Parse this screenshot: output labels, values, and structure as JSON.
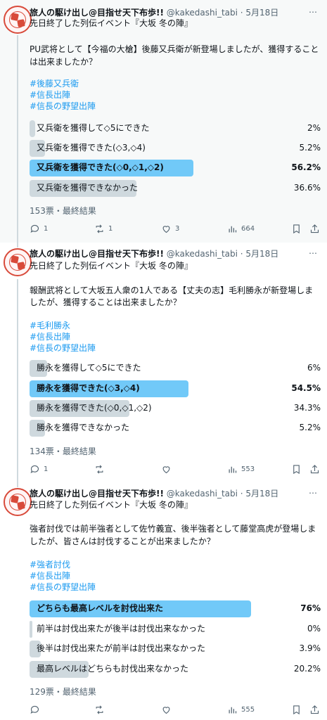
{
  "tweets": [
    {
      "author": {
        "name": "旅人の駆け出し@目指せ天下布歩!!",
        "handle": "@kakedashi_tabi",
        "date": "5月18日"
      },
      "text1": "先日終了した列伝イベント『大坂 冬の陣』",
      "text2a": "PU武将として【今福の大槍】後藤又兵衛が新登場しましたが、獲得すること",
      "text2b": "は出来ましたか？",
      "hashtags": [
        "#後藤又兵衛",
        "#信長出陣",
        "#信長の野望出陣"
      ],
      "poll": {
        "options": [
          {
            "label": "又兵衛を獲得して◇5にできた",
            "percent": "2%",
            "value": 2,
            "winner": false
          },
          {
            "label": "又兵衛を獲得できた(◇3,◇4)",
            "percent": "5.2%",
            "value": 5.2,
            "winner": false
          },
          {
            "label": "又兵衛を獲得できた(◇0,◇1,◇2)",
            "percent": "56.2%",
            "value": 56.2,
            "winner": true
          },
          {
            "label": "又兵衛を獲得できなかった",
            "percent": "36.6%",
            "value": 36.6,
            "winner": false
          }
        ],
        "footer": "153票・最終結果"
      },
      "stats": {
        "replies": "1",
        "reposts": "1",
        "likes": "3",
        "views": "664"
      }
    },
    {
      "author": {
        "name": "旅人の駆け出し@目指せ天下布歩!!",
        "handle": "@kakedashi_tabi",
        "date": "5月18日"
      },
      "text1": "先日終了した列伝イベント『大坂 冬の陣』",
      "text2a": "報酬武将として大坂五人衆の1人である【丈夫の志】毛利勝永が新登場しま",
      "text2b": "したが、獲得することは出来ましたか？",
      "hashtags": [
        "#毛利勝永",
        "#信長出陣",
        "#信長の野望出陣"
      ],
      "poll": {
        "options": [
          {
            "label": "勝永を獲得して◇5にできた",
            "percent": "6%",
            "value": 6,
            "winner": false
          },
          {
            "label": "勝永を獲得できた(◇3,◇4)",
            "percent": "54.5%",
            "value": 54.5,
            "winner": true
          },
          {
            "label": "勝永を獲得できた(◇0,◇1,◇2)",
            "percent": "34.3%",
            "value": 34.3,
            "winner": false
          },
          {
            "label": "勝永を獲得できなかった",
            "percent": "5.2%",
            "value": 5.2,
            "winner": false
          }
        ],
        "footer": "134票・最終結果"
      },
      "stats": {
        "replies": "1",
        "reposts": "",
        "likes": "",
        "views": "553"
      }
    },
    {
      "author": {
        "name": "旅人の駆け出し@目指せ天下布歩!!",
        "handle": "@kakedashi_tabi",
        "date": "5月18日"
      },
      "text1": "先日終了した列伝イベント『大坂 冬の陣』",
      "text2a": "強者討伐では前半強者として佐竹義宣、後半強者として藤堂高虎が登場しま",
      "text2b": "したが、皆さんは討伐することが出来ましたか？",
      "hashtags": [
        "#強者討伐",
        "#信長出陣",
        "#信長の野望出陣"
      ],
      "poll": {
        "options": [
          {
            "label": "どちらも最高レベルを討伐出来た",
            "percent": "76%",
            "value": 76,
            "winner": true
          },
          {
            "label": "前半は討伐出来たが後半は討伐出来なかった",
            "percent": "0%",
            "value": 0,
            "winner": false
          },
          {
            "label": "後半は討伐出来たが前半は討伐出来なかった",
            "percent": "3.9%",
            "value": 3.9,
            "winner": false
          },
          {
            "label": "最高レベルはどちらも討伐出来なかった",
            "percent": "20.2%",
            "value": 20.2,
            "winner": false
          }
        ],
        "footer": "129票・最終結果"
      },
      "stats": {
        "replies": "",
        "reposts": "",
        "likes": "",
        "views": "555"
      }
    }
  ],
  "ui": {
    "more_glyph": "…",
    "separator": " · ",
    "accent": "#1d9bf0",
    "winner_bar": "#71c9f8",
    "loser_bar": "#cfd9de"
  }
}
